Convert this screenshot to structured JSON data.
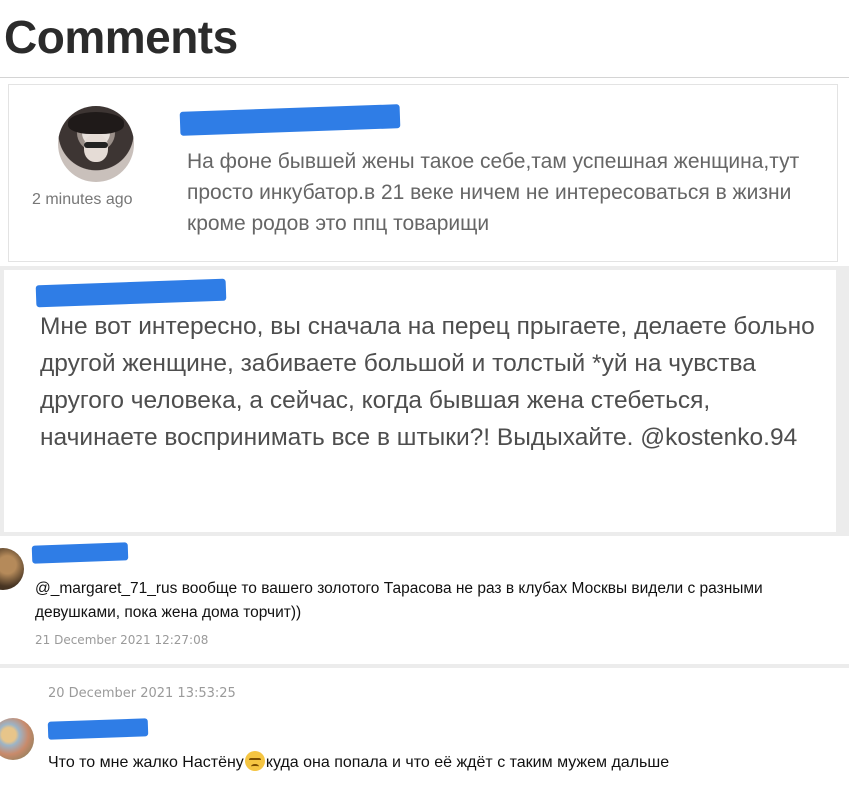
{
  "panels": [
    {
      "heading": "Comments",
      "time": "2 minutes ago",
      "text": "На фоне бывшей жены такое себе,там успешная женщина,тут просто инкубатор.в 21 веке ничем не интересоваться в жизни кроме родов это ппц товарищи"
    },
    {
      "text": "Мне вот интересно, вы сначала на перец прыгаете, делаете больно другой женщине, забиваете большой и толстый *уй на чувства другого человека, а сейчас, когда бывшая жена стебеться, начинаете воспринимать все в штыки?! Выдыхайте. @kostenko.94"
    },
    {
      "text": "@_margaret_71_rus вообще то вашего золотого Тарасова не раз в клубах Москвы видели с разными девушками, пока жена дома торчит))",
      "date": "21 December 2021 12:27:08"
    },
    {
      "date": "20 December 2021 13:53:25",
      "text_before_emoji": "Что то мне жалко Настёну",
      "emoji": "unamused-face-emoji",
      "text_after_emoji": "куда она попала и что её ждёт с таким мужем дальше"
    }
  ],
  "colors": {
    "redaction": "#2f7de6",
    "background": "#ececec",
    "panel": "#ffffff"
  }
}
